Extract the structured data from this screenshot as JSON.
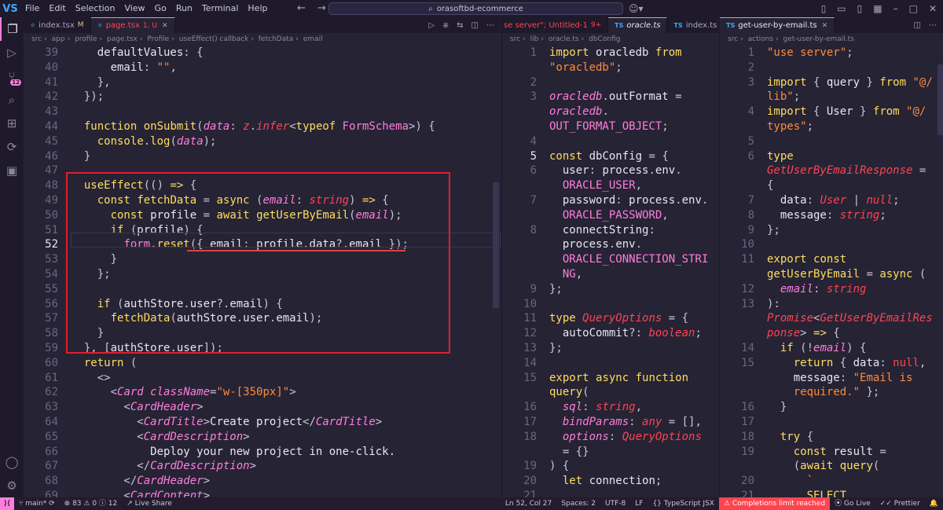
{
  "titlebar": {
    "logo": "VS",
    "menu": [
      "File",
      "Edit",
      "Selection",
      "View",
      "Go",
      "Run",
      "Terminal",
      "Help"
    ],
    "search_text": "orasoftbd-ecommerce",
    "back_icon": "arrow-left-icon",
    "forward_icon": "arrow-right-icon"
  },
  "activity": {
    "items": [
      "explorer-icon",
      "search-icon",
      "source-control-icon",
      "run-debug-icon",
      "extensions-icon",
      "remote-explorer-icon",
      "testing-icon"
    ],
    "source_control_badge": "12",
    "bottom": [
      "account-icon",
      "settings-icon"
    ]
  },
  "pane1": {
    "tabs": [
      {
        "label": "index.tsx",
        "status": "M",
        "active": false
      },
      {
        "label": "page.tsx",
        "status": "1, U",
        "active": true
      }
    ],
    "breadcrumb": [
      "src",
      "app",
      "profile",
      "page.tsx",
      "Profile",
      "useEffect() callback",
      "fetchData",
      "email"
    ]
  },
  "pane2": {
    "tabs": [
      {
        "label": "se server\"; Untitled-1",
        "status": "9+",
        "active": false
      },
      {
        "label": "oracle.ts",
        "active": true
      },
      {
        "label": "index.ts",
        "active": false
      }
    ],
    "breadcrumb": [
      "src",
      "lib",
      "oracle.ts",
      "dbConfig"
    ]
  },
  "pane3": {
    "tabs": [
      {
        "label": "oracle.ts",
        "active": false
      },
      {
        "label": "get-user-by-email.ts",
        "active": true
      }
    ],
    "breadcrumb": [
      "src",
      "actions",
      "get-user-by-email.ts"
    ]
  },
  "statusbar": {
    "branch": "main*",
    "problems": "83",
    "warnings": "0",
    "info": "12",
    "live_share": "Live Share",
    "position": "Ln 52, Col 27",
    "spaces": "Spaces: 2",
    "encoding": "UTF-8",
    "eol": "LF",
    "language": "TypeScript JSX",
    "completions": "Completions limit reached",
    "go_live": "Go Live",
    "prettier": "Prettier"
  }
}
